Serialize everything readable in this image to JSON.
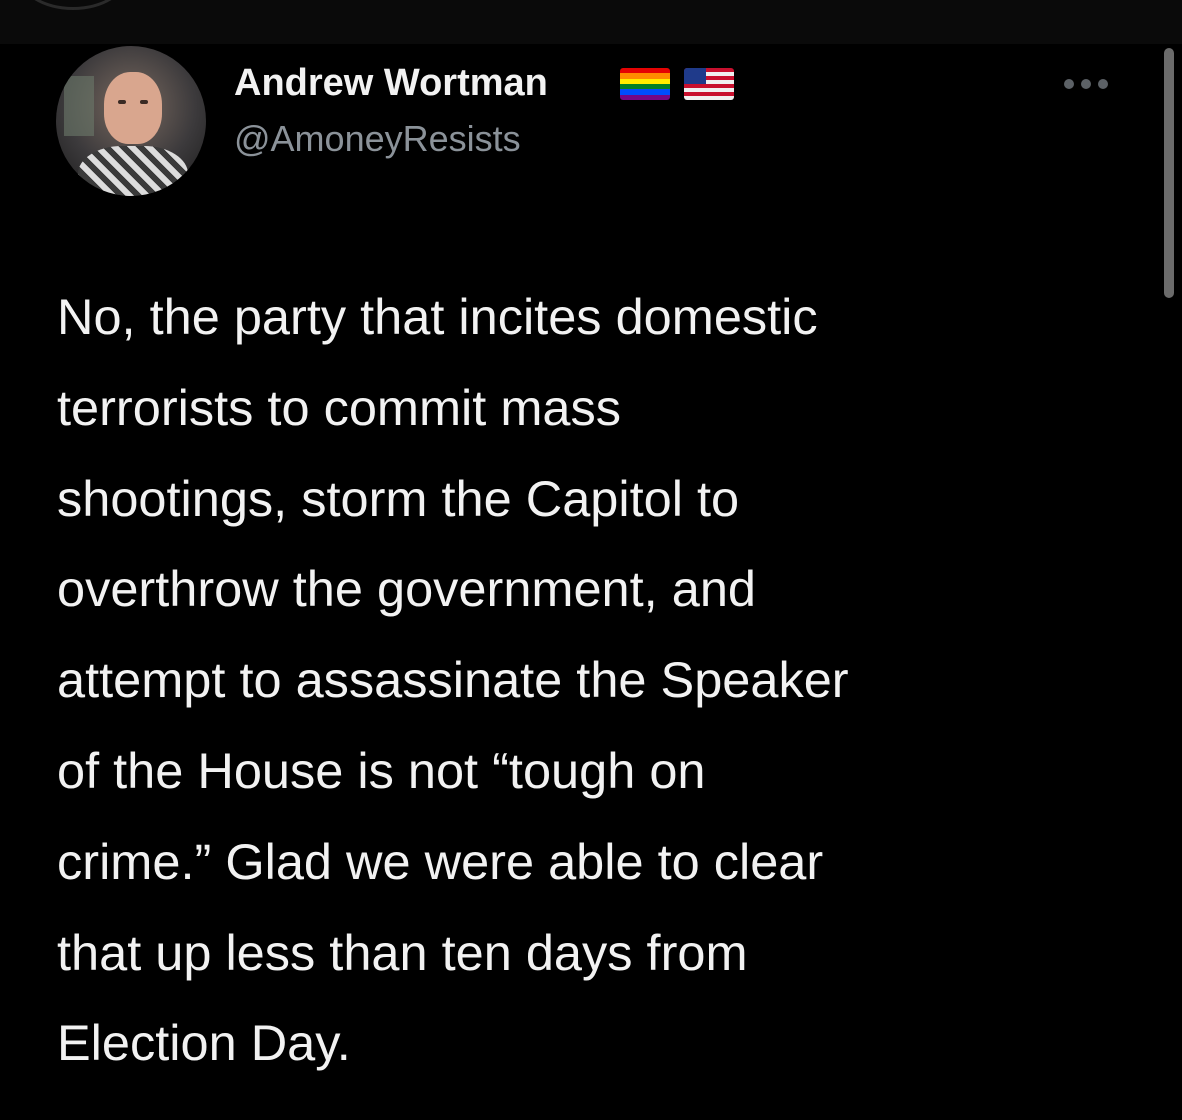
{
  "tweet": {
    "author": {
      "display_name": "Andrew Wortman",
      "handle": "@AmoneyResists",
      "badges": [
        "rainbow-flag-icon",
        "us-flag-icon"
      ]
    },
    "text_lines": [
      "No, the party that incites domestic",
      "terrorists to commit mass",
      "shootings, storm the Capitol to",
      "overthrow the government, and",
      "attempt to assassinate the Speaker",
      "of the House is not “tough on",
      "crime.” Glad we were able to clear",
      "that up less than ten days from",
      "Election Day."
    ],
    "more_menu_icon": "more-options-icon"
  },
  "colors": {
    "background": "#000000",
    "primary_text": "#f2f2f2",
    "secondary_text": "#8b9299",
    "pride_flag": [
      "#e40303",
      "#ff8c00",
      "#ffed00",
      "#008026",
      "#004dff",
      "#750787"
    ]
  }
}
